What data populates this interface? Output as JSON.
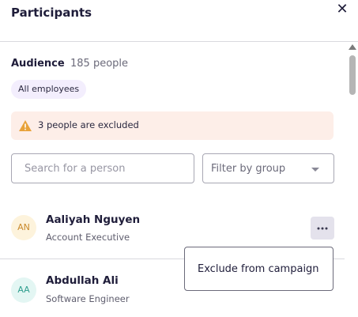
{
  "header": {
    "title": "Participants",
    "close_label": "✕"
  },
  "audience": {
    "label": "Audience",
    "count": "185 people",
    "chip": "All employees"
  },
  "alert": {
    "text": "3 people are excluded",
    "color": "#fdeee8",
    "icon": "warning-icon"
  },
  "search": {
    "placeholder": "Search for a person"
  },
  "filter": {
    "label": "Filter by group"
  },
  "people": [
    {
      "initials": "AN",
      "name": "Aaliyah Nguyen",
      "role": "Account Executive",
      "avatar_bg": "#fdf3dc",
      "avatar_fg": "#c9892b"
    },
    {
      "initials": "AA",
      "name": "Abdullah Ali",
      "role": "Software Engineer",
      "avatar_bg": "#e3f6f3",
      "avatar_fg": "#2f9e8e"
    }
  ],
  "menu": {
    "more_icon": "more-horizontal-icon",
    "exclude": "Exclude from campaign"
  }
}
